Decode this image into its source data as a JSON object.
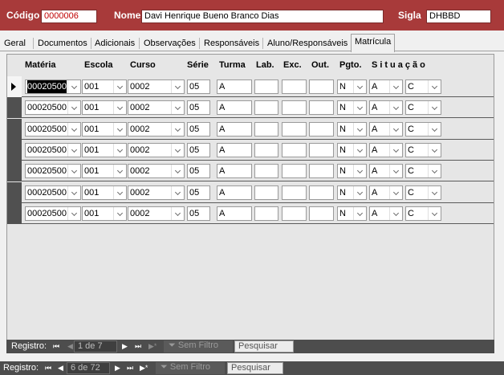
{
  "header": {
    "codigo_label": "Código",
    "codigo_value": "0000006",
    "nome_label": "Nome",
    "nome_value": "Davi Henrique Bueno Branco Dias",
    "sigla_label": "Sigla",
    "sigla_value": "DHBBD"
  },
  "tabs": [
    {
      "label": "Geral",
      "active": false
    },
    {
      "label": "Documentos",
      "active": false
    },
    {
      "label": "Adicionais",
      "active": false
    },
    {
      "label": "Observações",
      "active": false
    },
    {
      "label": "Responsáveis",
      "active": false
    },
    {
      "label": "Aluno/Responsáveis",
      "active": false
    },
    {
      "label": "Matrícula",
      "active": true
    }
  ],
  "grid": {
    "columns": [
      "Matéria",
      "Escola",
      "Curso",
      "Série",
      "Turma",
      "Lab.",
      "Exc.",
      "Out.",
      "Pgto.",
      "Situação"
    ],
    "rows": [
      {
        "materia": "00020500",
        "escola": "001",
        "curso": "0002",
        "serie": "05",
        "turma": "A",
        "lab": "",
        "exc": "",
        "out": "",
        "pgto": "N",
        "sit1": "A",
        "sit2": "C"
      },
      {
        "materia": "00020500",
        "escola": "001",
        "curso": "0002",
        "serie": "05",
        "turma": "A",
        "lab": "",
        "exc": "",
        "out": "",
        "pgto": "N",
        "sit1": "A",
        "sit2": "C"
      },
      {
        "materia": "00020500",
        "escola": "001",
        "curso": "0002",
        "serie": "05",
        "turma": "A",
        "lab": "",
        "exc": "",
        "out": "",
        "pgto": "N",
        "sit1": "A",
        "sit2": "C"
      },
      {
        "materia": "00020500",
        "escola": "001",
        "curso": "0002",
        "serie": "05",
        "turma": "A",
        "lab": "",
        "exc": "",
        "out": "",
        "pgto": "N",
        "sit1": "A",
        "sit2": "C"
      },
      {
        "materia": "00020500",
        "escola": "001",
        "curso": "0002",
        "serie": "05",
        "turma": "A",
        "lab": "",
        "exc": "",
        "out": "",
        "pgto": "N",
        "sit1": "A",
        "sit2": "C"
      },
      {
        "materia": "00020500",
        "escola": "001",
        "curso": "0002",
        "serie": "05",
        "turma": "A",
        "lab": "",
        "exc": "",
        "out": "",
        "pgto": "N",
        "sit1": "A",
        "sit2": "C"
      },
      {
        "materia": "00020500",
        "escola": "001",
        "curso": "0002",
        "serie": "05",
        "turma": "A",
        "lab": "",
        "exc": "",
        "out": "",
        "pgto": "N",
        "sit1": "A",
        "sit2": "C"
      }
    ]
  },
  "subform_nav": {
    "label": "Registro:",
    "position": "1 de 7",
    "filter": "Sem Filtro",
    "search": "Pesquisar",
    "btn_first": "⏮",
    "btn_prev": "◀",
    "btn_next": "▶",
    "btn_last": "⏭",
    "btn_new": "▶*"
  },
  "form_nav": {
    "label": "Registro:",
    "position": "6 de 72",
    "filter": "Sem Filtro",
    "search": "Pesquisar",
    "btn_first": "⏮",
    "btn_prev": "◀",
    "btn_next": "▶",
    "btn_last": "⏭",
    "btn_new": "▶*"
  },
  "colors": {
    "header_bg": "#a83a3a",
    "nav_bg": "#4d4d4d",
    "row_selector": "#505050"
  }
}
